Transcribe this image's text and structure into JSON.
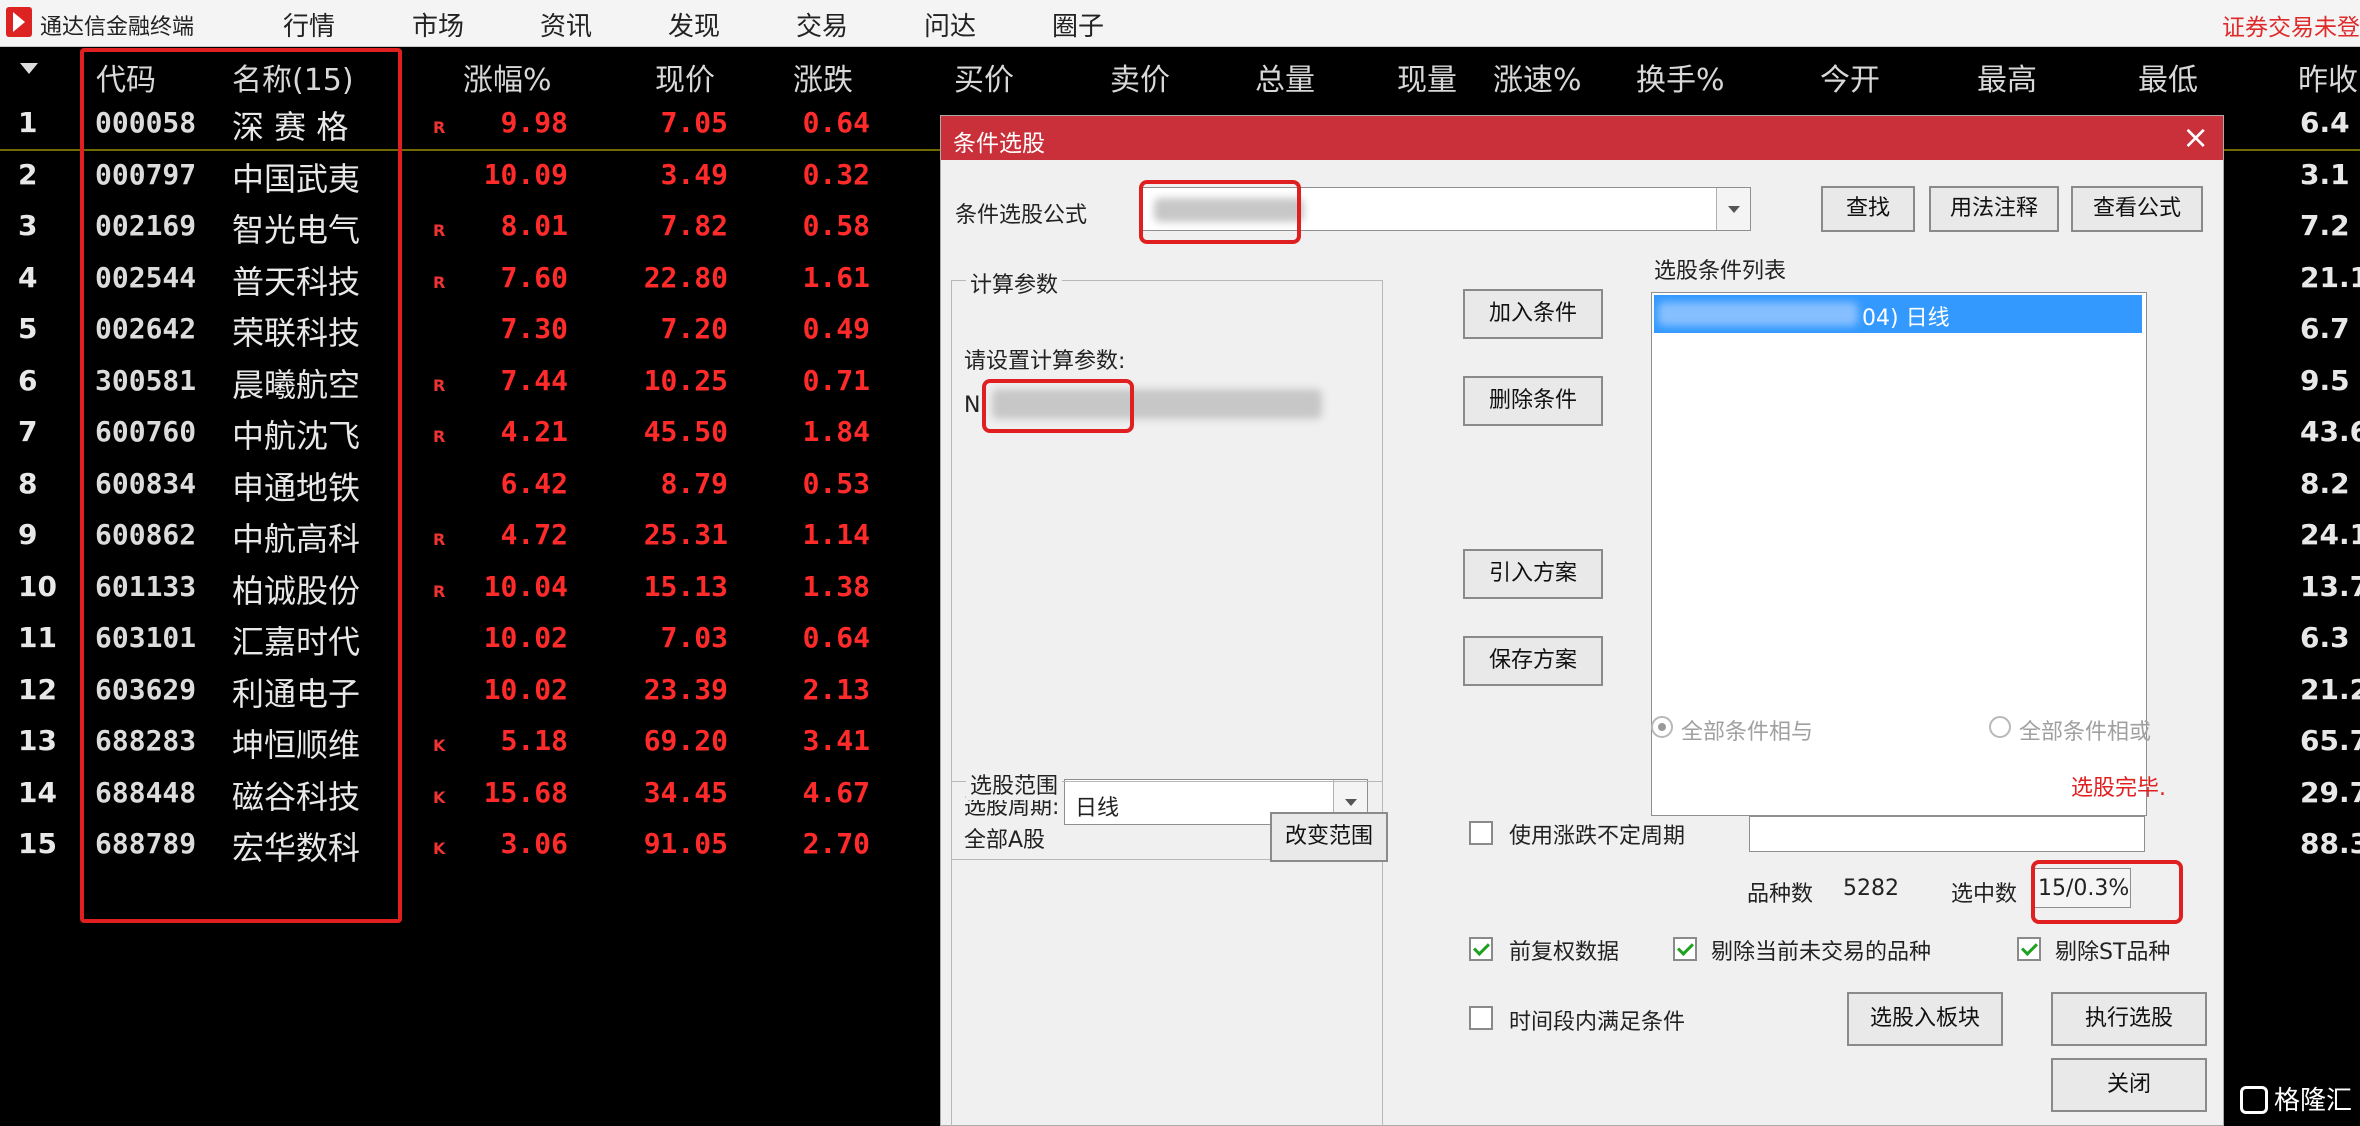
{
  "app": {
    "title": "通达信金融终端",
    "menu": [
      "行情",
      "市场",
      "资讯",
      "发现",
      "交易",
      "问达",
      "圈子"
    ],
    "status": "证券交易未登"
  },
  "table": {
    "headers": [
      "代码",
      "名称(15)",
      "涨幅%",
      "现价",
      "涨跌",
      "买价",
      "卖价",
      "总量",
      "现量",
      "涨速%",
      "换手%",
      "今开",
      "最高",
      "最低",
      "昨收"
    ],
    "rows": [
      {
        "idx": "1",
        "code": "000058",
        "name": "深 赛 格",
        "tag": "R",
        "chg_pct": "9.98",
        "price": "7.05",
        "change": "0.64",
        "prev": "6.4"
      },
      {
        "idx": "2",
        "code": "000797",
        "name": "中国武夷",
        "tag": "",
        "chg_pct": "10.09",
        "price": "3.49",
        "change": "0.32",
        "prev": "3.1"
      },
      {
        "idx": "3",
        "code": "002169",
        "name": "智光电气",
        "tag": "R",
        "chg_pct": "8.01",
        "price": "7.82",
        "change": "0.58",
        "prev": "7.2"
      },
      {
        "idx": "4",
        "code": "002544",
        "name": "普天科技",
        "tag": "R",
        "chg_pct": "7.60",
        "price": "22.80",
        "change": "1.61",
        "prev": "21.1"
      },
      {
        "idx": "5",
        "code": "002642",
        "name": "荣联科技",
        "tag": "",
        "chg_pct": "7.30",
        "price": "7.20",
        "change": "0.49",
        "prev": "6.7"
      },
      {
        "idx": "6",
        "code": "300581",
        "name": "晨曦航空",
        "tag": "R",
        "chg_pct": "7.44",
        "price": "10.25",
        "change": "0.71",
        "prev": "9.5"
      },
      {
        "idx": "7",
        "code": "600760",
        "name": "中航沈飞",
        "tag": "R",
        "chg_pct": "4.21",
        "price": "45.50",
        "change": "1.84",
        "prev": "43.6"
      },
      {
        "idx": "8",
        "code": "600834",
        "name": "申通地铁",
        "tag": "",
        "chg_pct": "6.42",
        "price": "8.79",
        "change": "0.53",
        "prev": "8.2"
      },
      {
        "idx": "9",
        "code": "600862",
        "name": "中航高科",
        "tag": "R",
        "chg_pct": "4.72",
        "price": "25.31",
        "change": "1.14",
        "prev": "24.1"
      },
      {
        "idx": "10",
        "code": "601133",
        "name": "柏诚股份",
        "tag": "R",
        "chg_pct": "10.04",
        "price": "15.13",
        "change": "1.38",
        "prev": "13.7"
      },
      {
        "idx": "11",
        "code": "603101",
        "name": "汇嘉时代",
        "tag": "",
        "chg_pct": "10.02",
        "price": "7.03",
        "change": "0.64",
        "prev": "6.3"
      },
      {
        "idx": "12",
        "code": "603629",
        "name": "利通电子",
        "tag": "",
        "chg_pct": "10.02",
        "price": "23.39",
        "change": "2.13",
        "prev": "21.2"
      },
      {
        "idx": "13",
        "code": "688283",
        "name": "坤恒顺维",
        "tag": "K",
        "chg_pct": "5.18",
        "price": "69.20",
        "change": "3.41",
        "prev": "65.7"
      },
      {
        "idx": "14",
        "code": "688448",
        "name": "磁谷科技",
        "tag": "K",
        "chg_pct": "15.68",
        "price": "34.45",
        "change": "4.67",
        "prev": "29.7"
      },
      {
        "idx": "15",
        "code": "688789",
        "name": "宏华数科",
        "tag": "K",
        "chg_pct": "3.06",
        "price": "91.05",
        "change": "2.70",
        "prev": "88.3"
      }
    ]
  },
  "dialog": {
    "title": "条件选股",
    "close": "×",
    "formula_label": "条件选股公式",
    "btn_find": "查找",
    "btn_usage": "用法注释",
    "btn_view": "查看公式",
    "calc_params_title": "计算参数",
    "calc_params_hint": "请设置计算参数:",
    "param_prefix": "N:",
    "cond_list_title": "选股条件列表",
    "cond_item_suffix": "04) 日线",
    "btn_add": "加入条件",
    "btn_delete": "删除条件",
    "btn_import": "引入方案",
    "btn_save": "保存方案",
    "period_label": "选股周期:",
    "period_value": "日线",
    "radio_and": "全部条件相与",
    "radio_or": "全部条件相或",
    "done_text": "选股完毕.",
    "range_title": "选股范围",
    "range_value": "全部A股",
    "btn_change_range": "改变范围",
    "use_period_label": "使用涨跌不定周期",
    "total_label": "品种数",
    "total_value": "5282",
    "selected_label": "选中数",
    "selected_value": "15/0.3%",
    "chk_adjust": "前复权数据",
    "chk_remove_untraded": "剔除当前未交易的品种",
    "chk_remove_st": "剔除ST品种",
    "chk_time_range": "时间段内满足条件",
    "btn_to_block": "选股入板块",
    "btn_execute": "执行选股",
    "btn_close": "关闭"
  },
  "watermark": "格隆汇",
  "colors": {
    "up": "#ff2a2a",
    "titlebar": "#c9303a",
    "highlight": "#e02020"
  }
}
